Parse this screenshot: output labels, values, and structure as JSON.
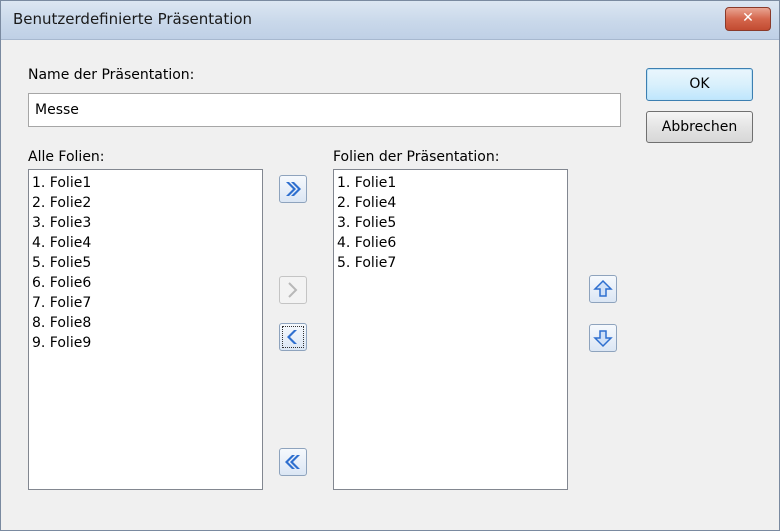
{
  "window": {
    "title": "Benutzerdefinierte Präsentation",
    "close_label": "✕"
  },
  "name_field": {
    "label": "Name der Präsentation:",
    "value": "Messe"
  },
  "buttons": {
    "ok": "OK",
    "cancel": "Abbrechen"
  },
  "all_slides": {
    "label": "Alle Folien:",
    "items": [
      "1. Folie1",
      "2. Folie2",
      "3. Folie3",
      "4. Folie4",
      "5. Folie5",
      "6. Folie6",
      "7. Folie7",
      "8. Folie8",
      "9. Folie9"
    ]
  },
  "presentation_slides": {
    "label": "Folien der Präsentation:",
    "items": [
      "1. Folie1",
      "2. Folie4",
      "3. Folie5",
      "4. Folie6",
      "5. Folie7"
    ]
  },
  "colors": {
    "arrow_blue": "#2e6fcf",
    "arrow_disabled": "#b8b8b8"
  }
}
